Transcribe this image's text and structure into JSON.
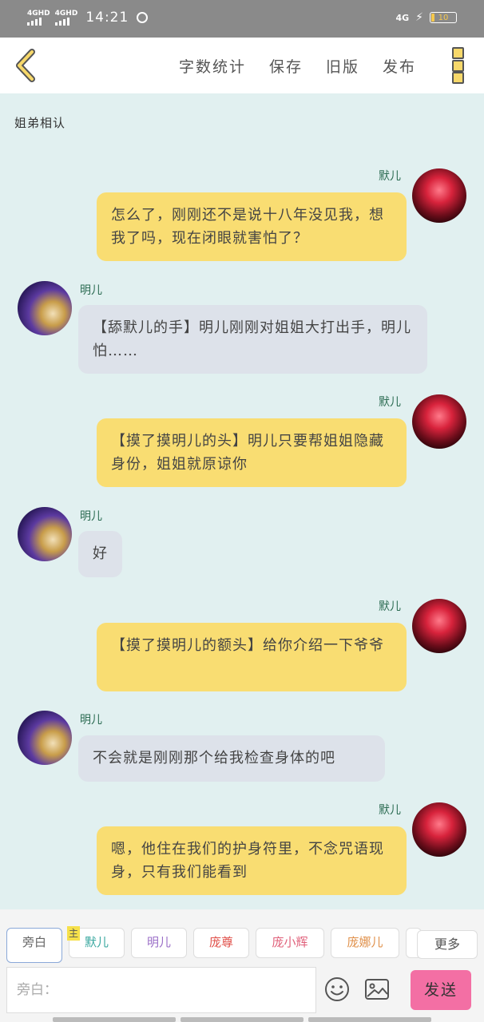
{
  "status_bar": {
    "net1": "4GHD",
    "net2": "4GHD",
    "time": "14:21",
    "net_right": "4G",
    "battery": "10"
  },
  "toolbar": {
    "actions": [
      "字数统计",
      "保存",
      "旧版",
      "发布"
    ]
  },
  "chat": {
    "title": "姐弟相认",
    "messages": [
      {
        "side": "right",
        "name": "默儿",
        "text": "怎么了，刚刚还不是说十八年没见我，想我了吗，现在闭眼就害怕了？"
      },
      {
        "side": "left",
        "name": "明儿",
        "text": "【舔默儿的手】明儿刚刚对姐姐大打出手，明儿怕……"
      },
      {
        "side": "right",
        "name": "默儿",
        "text": "【摸了摸明儿的头】明儿只要帮姐姐隐藏身份，姐姐就原谅你"
      },
      {
        "side": "left",
        "name": "明儿",
        "text": "好"
      },
      {
        "side": "right",
        "name": "默儿",
        "text": "【摸了摸明儿的额头】给你介绍一下爷爷"
      },
      {
        "side": "left",
        "name": "明儿",
        "text": "不会就是刚刚那个给我检查身体的吧"
      },
      {
        "side": "right",
        "name": "默儿",
        "text": "嗯，他住在我们的护身符里，不念咒语现身，只有我们能看到"
      }
    ]
  },
  "composer": {
    "host_badge": "主",
    "roles": [
      {
        "label": "旁白",
        "color": "#666666"
      },
      {
        "label": "默儿",
        "color": "#3aa8a0"
      },
      {
        "label": "明儿",
        "color": "#9b6fc8"
      },
      {
        "label": "庞尊",
        "color": "#e0504a"
      },
      {
        "label": "庞小辉",
        "color": "#e0607a"
      },
      {
        "label": "庞娜儿",
        "color": "#e0904a"
      }
    ],
    "more_label": "更多",
    "input_placeholder": "旁白：",
    "send_label": "发送"
  }
}
